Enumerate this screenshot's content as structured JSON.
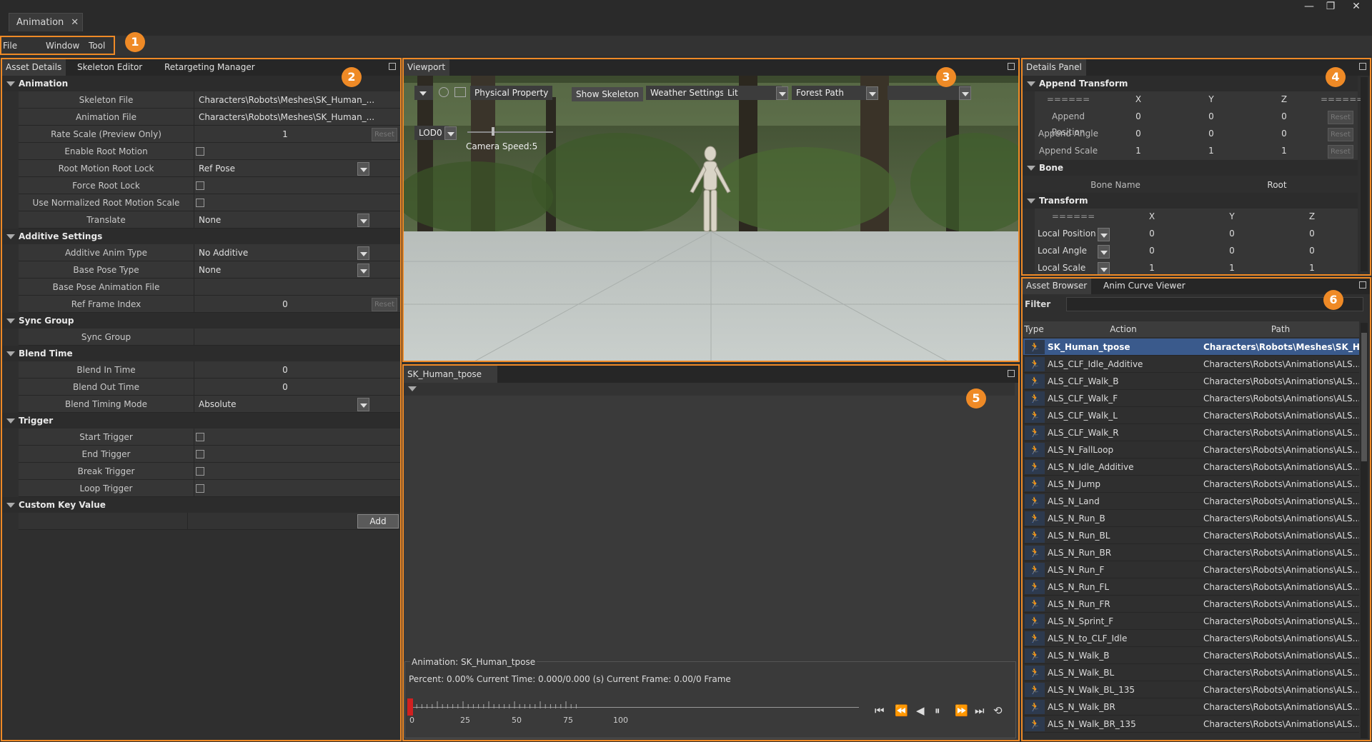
{
  "window": {
    "tab_title": "Animation",
    "min": "—",
    "restore": "❐",
    "close": "✕"
  },
  "menu": {
    "file": "File",
    "window": "Window",
    "tool": "Tool"
  },
  "badges": [
    "1",
    "2",
    "3",
    "4",
    "5",
    "6"
  ],
  "left": {
    "tabs": [
      "Asset Details",
      "Skeleton Editor",
      "Retargeting Manager"
    ],
    "sections": {
      "animation": "Animation",
      "additive": "Additive Settings",
      "sync": "Sync Group",
      "blend": "Blend Time",
      "trigger": "Trigger",
      "custom": "Custom Key Value"
    },
    "rows": [
      {
        "label": "Skeleton File",
        "value": "Characters\\Robots\\Meshes\\SK_Human_..."
      },
      {
        "label": "Animation File",
        "value": "Characters\\Robots\\Meshes\\SK_Human_..."
      },
      {
        "label": "Rate Scale (Preview Only)",
        "value": "1"
      },
      {
        "label": "Enable Root Motion",
        "value": ""
      },
      {
        "label": "Root Motion Root Lock",
        "value": "Ref Pose"
      },
      {
        "label": "Force Root Lock",
        "value": ""
      },
      {
        "label": "Use Normalized Root Motion Scale",
        "value": ""
      },
      {
        "label": "Translate",
        "value": "None"
      },
      {
        "label": "Additive Anim Type",
        "value": "No Additive"
      },
      {
        "label": "Base Pose Type",
        "value": "None"
      },
      {
        "label": "Base Pose Animation File",
        "value": ""
      },
      {
        "label": "Ref Frame Index",
        "value": "0"
      },
      {
        "label": "Sync Group",
        "value": ""
      },
      {
        "label": "Blend In Time",
        "value": "0"
      },
      {
        "label": "Blend Out Time",
        "value": "0"
      },
      {
        "label": "Blend Timing Mode",
        "value": "Absolute"
      },
      {
        "label": "Start Trigger",
        "value": ""
      },
      {
        "label": "End Trigger",
        "value": ""
      },
      {
        "label": "Break Trigger",
        "value": ""
      },
      {
        "label": "Loop Trigger",
        "value": ""
      }
    ],
    "reset": "Reset",
    "add": "Add"
  },
  "viewport": {
    "tab": "Viewport",
    "physical": "Physical Property",
    "show_skeleton": "Show Skeleton",
    "weather": "Weather Settings",
    "lit": "Lit",
    "scene": "Forest Path",
    "lod": "LOD0",
    "camera_speed": "Camera Speed:5"
  },
  "timeline": {
    "tab": "SK_Human_tpose",
    "group": "Animation: SK_Human_tpose",
    "status": "Percent: 0.00% Current Time: 0.000/0.000 (s) Current Frame: 0.00/0 Frame",
    "ticks": [
      "0",
      "25",
      "50",
      "75",
      "100"
    ]
  },
  "details": {
    "tab": "Details Panel",
    "append": "Append Transform",
    "bone": "Bone",
    "transform": "Transform",
    "sep": "======",
    "axes": [
      "X",
      "Y",
      "Z"
    ],
    "append_rows": [
      {
        "label": "Append Position",
        "values": [
          "0",
          "0",
          "0"
        ]
      },
      {
        "label": "Append Angle",
        "values": [
          "0",
          "0",
          "0"
        ]
      },
      {
        "label": "Append Scale",
        "values": [
          "1",
          "1",
          "1"
        ]
      }
    ],
    "bone_name": "Bone Name",
    "bone_value": "Root",
    "transform_rows": [
      {
        "label": "Local Position",
        "values": [
          "0",
          "0",
          "0"
        ]
      },
      {
        "label": "Local Angle",
        "values": [
          "0",
          "0",
          "0"
        ]
      },
      {
        "label": "Local Scale",
        "values": [
          "1",
          "1",
          "1"
        ]
      }
    ]
  },
  "browser": {
    "tabs": [
      "Asset Browser",
      "Anim Curve Viewer"
    ],
    "filter": "Filter",
    "cols": [
      "Type",
      "Action",
      "Path"
    ],
    "items": [
      {
        "name": "SK_Human_tpose",
        "path": "Characters\\Robots\\Meshes\\SK_Hu..."
      },
      {
        "name": "ALS_CLF_Idle_Additive",
        "path": "Characters\\Robots\\Animations\\ALS..."
      },
      {
        "name": "ALS_CLF_Walk_B",
        "path": "Characters\\Robots\\Animations\\ALS..."
      },
      {
        "name": "ALS_CLF_Walk_F",
        "path": "Characters\\Robots\\Animations\\ALS..."
      },
      {
        "name": "ALS_CLF_Walk_L",
        "path": "Characters\\Robots\\Animations\\ALS..."
      },
      {
        "name": "ALS_CLF_Walk_R",
        "path": "Characters\\Robots\\Animations\\ALS..."
      },
      {
        "name": "ALS_N_FallLoop",
        "path": "Characters\\Robots\\Animations\\ALS..."
      },
      {
        "name": "ALS_N_Idle_Additive",
        "path": "Characters\\Robots\\Animations\\ALS..."
      },
      {
        "name": "ALS_N_Jump",
        "path": "Characters\\Robots\\Animations\\ALS..."
      },
      {
        "name": "ALS_N_Land",
        "path": "Characters\\Robots\\Animations\\ALS..."
      },
      {
        "name": "ALS_N_Run_B",
        "path": "Characters\\Robots\\Animations\\ALS..."
      },
      {
        "name": "ALS_N_Run_BL",
        "path": "Characters\\Robots\\Animations\\ALS..."
      },
      {
        "name": "ALS_N_Run_BR",
        "path": "Characters\\Robots\\Animations\\ALS..."
      },
      {
        "name": "ALS_N_Run_F",
        "path": "Characters\\Robots\\Animations\\ALS..."
      },
      {
        "name": "ALS_N_Run_FL",
        "path": "Characters\\Robots\\Animations\\ALS..."
      },
      {
        "name": "ALS_N_Run_FR",
        "path": "Characters\\Robots\\Animations\\ALS..."
      },
      {
        "name": "ALS_N_Sprint_F",
        "path": "Characters\\Robots\\Animations\\ALS..."
      },
      {
        "name": "ALS_N_to_CLF_Idle",
        "path": "Characters\\Robots\\Animations\\ALS..."
      },
      {
        "name": "ALS_N_Walk_B",
        "path": "Characters\\Robots\\Animations\\ALS..."
      },
      {
        "name": "ALS_N_Walk_BL",
        "path": "Characters\\Robots\\Animations\\ALS..."
      },
      {
        "name": "ALS_N_Walk_BL_135",
        "path": "Characters\\Robots\\Animations\\ALS..."
      },
      {
        "name": "ALS_N_Walk_BR",
        "path": "Characters\\Robots\\Animations\\ALS..."
      },
      {
        "name": "ALS_N_Walk_BR_135",
        "path": "Characters\\Robots\\Animations\\ALS..."
      }
    ]
  },
  "colors": {
    "accent": "#ef8a26",
    "selection": "#3a5a8c",
    "playhead": "#d02020"
  }
}
